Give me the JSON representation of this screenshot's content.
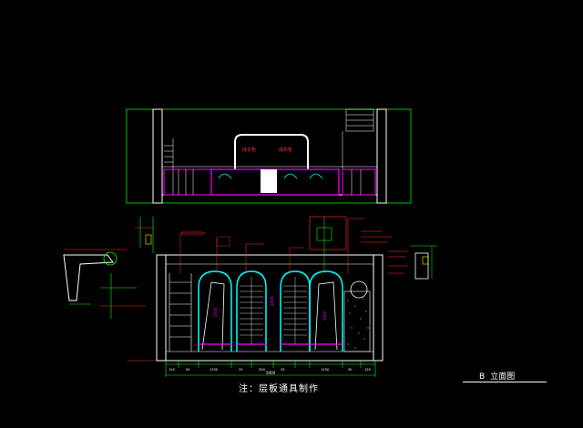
{
  "drawing": {
    "background": "#000000",
    "note": "注：层板通具制作",
    "view_label": {
      "letter": "B",
      "text": "立面图"
    },
    "tags": {
      "cabinet_left": "成衣柜",
      "cabinet_right": "成衣柜"
    },
    "dimensions": {
      "heights": [
        "2800",
        "2500",
        "2450"
      ],
      "widths": [
        "150",
        "50",
        "1250",
        "25",
        "300",
        "25",
        "1250",
        "50",
        "150"
      ],
      "total": "5000"
    },
    "colors": {
      "frame_green": "#00c000",
      "line_white": "#ffffff",
      "accent_magenta": "#ff00ff",
      "accent_cyan": "#00ffff",
      "annotation_red": "#ff3030",
      "dim_green": "#00ff00",
      "detail_yellow": "#ffff00"
    }
  }
}
